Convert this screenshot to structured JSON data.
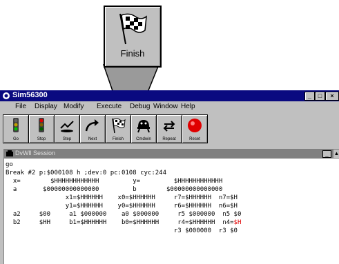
{
  "callout": {
    "label": "Finish",
    "icon": "checkered-flag-icon"
  },
  "window": {
    "title": "Sim56300",
    "controls": [
      "_",
      "□",
      "×"
    ],
    "menu": [
      "File",
      "Display",
      "Modify",
      "Execute",
      "Debug",
      "Window",
      "Help"
    ]
  },
  "toolbar": {
    "buttons": [
      {
        "label": "Go",
        "icon": "traffic-light-icon"
      },
      {
        "label": "Stop",
        "icon": "traffic-light-red-icon"
      },
      {
        "label": "Step",
        "icon": "step-icon"
      },
      {
        "label": "Next",
        "icon": "next-arrow-icon"
      },
      {
        "label": "Finish",
        "icon": "checkered-flag-icon"
      },
      {
        "label": "Cmdwin",
        "icon": "cmdwin-icon"
      },
      {
        "label": "Repeat",
        "icon": "repeat-icon"
      },
      {
        "label": "Reset",
        "icon": "reset-circle-icon"
      }
    ]
  },
  "session": {
    "title": "DvWll Session",
    "lines": [
      [
        {
          "t": "go"
        }
      ],
      [
        {
          "t": "Break #2 p:$000108 h ;dev:0 pc:0108 cyc:244"
        }
      ],
      [
        {
          "t": "  x=        $HHHHHHHHHHHH         y=         $HHHHHHHHHHHH"
        }
      ],
      [
        {
          "t": "  a       $00000000000000         b        $00000000000000"
        }
      ],
      [
        {
          "t": "                x1=$HHHHHH    x0=$HHHHHH     r7=$HHHHHH  n7=$H"
        }
      ],
      [
        {
          "t": "                y1=$HHHHHH    y0=$HHHHHH     r6=$HHHHHH  n6=$H"
        }
      ],
      [
        {
          "t": "  a2     $00     a1 $000000    a0 $000000     r5 $000000  n5 $0"
        }
      ],
      [
        {
          "t": "  b2     $HH     b1=$HHHHHH    b0=$HHHHHH     r4=$HHHHHH  n4="
        },
        {
          "t": "$H",
          "red": true
        }
      ],
      [
        {
          "t": "                                             r3 $000000  r3 $0"
        }
      ]
    ]
  }
}
